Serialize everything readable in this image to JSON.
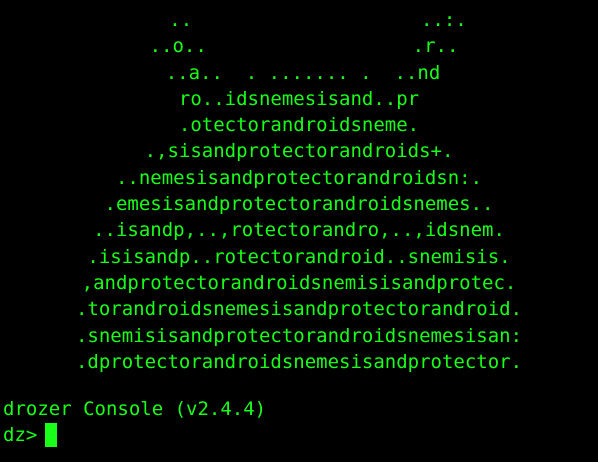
{
  "terminal": {
    "foreground_color": "#19ff19",
    "background_color": "#000000",
    "banner_lines": [
      "..                    ..:.",
      "..o..                  .r..",
      "..a..  . ....... .  ..nd",
      "ro..idsnemesisand..pr",
      ".otectorandroidsneme.",
      ".,sisandprotectorandroids+.",
      "..nemesisandprotectorandroidsn:.",
      ".emesisandprotectorandroidsnemes..",
      "..isandp,..,rotectorandro,..,idsnem.",
      ".isisandp..rotectorandroid..snemisis.",
      ",andprotectorandroidsnemisisandprotec.",
      ".torandroidsnemesisandprotectorandroid.",
      ".snemisisandprotectorandroidsnemesisan:",
      ".dprotectorandroidsnemesisandprotector."
    ],
    "console_title": "drozer Console (v2.4.4)",
    "prompt": "dz>"
  }
}
